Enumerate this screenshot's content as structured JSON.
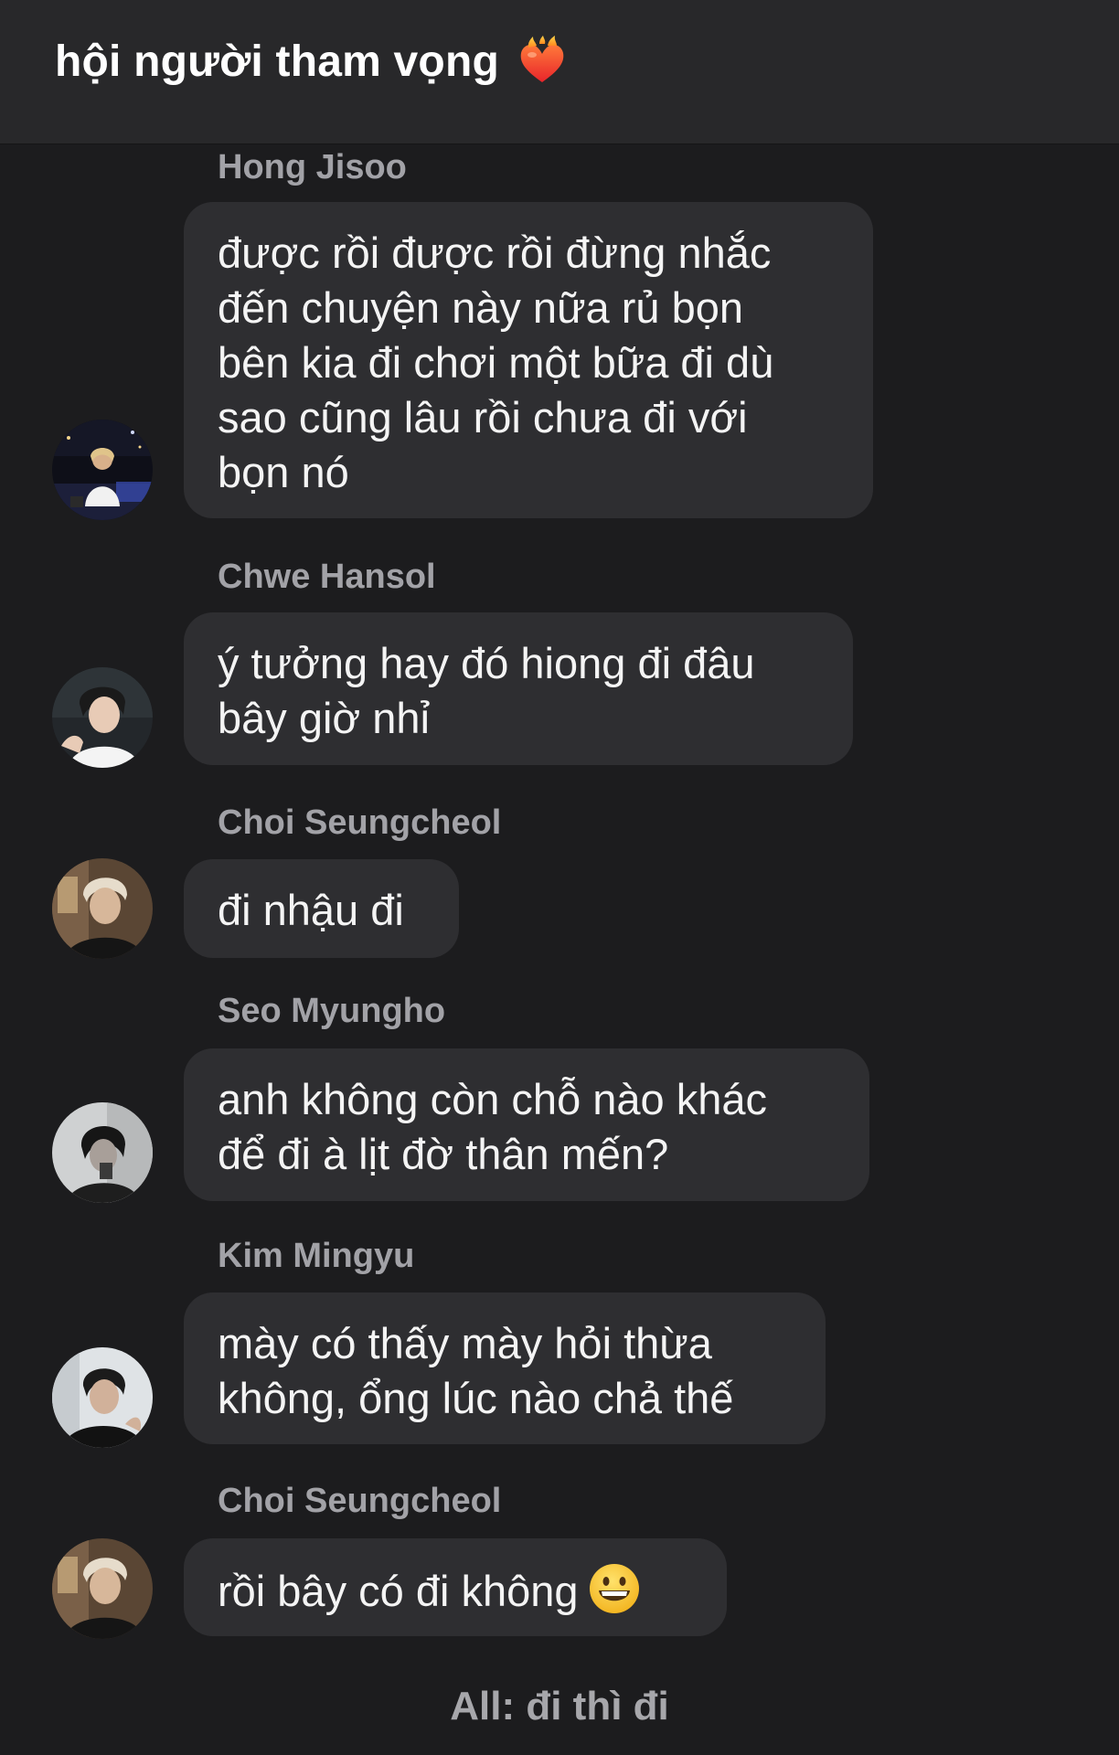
{
  "header": {
    "title": "hội người tham vọng",
    "title_icon": "flaming-heart-icon"
  },
  "messages": [
    {
      "sender": "Hong Jisoo",
      "text": "được rồi được rồi đừng nhắc\nđến chuyện này nữa rủ bọn\nbên kia đi chơi một bữa đi dù\nsao cũng lâu rồi chưa đi với\nbọn nó",
      "avatar": "avatar-photo"
    },
    {
      "sender": "Chwe Hansol",
      "text": "ý tưởng hay đó hiong đi đâu\nbây giờ nhỉ",
      "avatar": "avatar-photo"
    },
    {
      "sender": "Choi Seungcheol",
      "text": "đi nhậu đi",
      "avatar": "avatar-photo"
    },
    {
      "sender": "Seo Myungho",
      "text": "anh không còn chỗ nào khác\nđể đi à lịt đờ thân mến?",
      "avatar": "avatar-photo"
    },
    {
      "sender": "Kim Mingyu",
      "text": "mày có thấy mày hỏi thừa\nkhông, ổng lúc nào chả thế",
      "avatar": "avatar-photo"
    },
    {
      "sender": "Choi Seungcheol",
      "text": "rồi bây có đi không",
      "emoji": "grinning-face-icon",
      "avatar": "avatar-photo"
    }
  ],
  "footer": {
    "text": "All: đi thì đi"
  },
  "colors": {
    "background": "#1c1c1e",
    "header": "#28282a",
    "bubble": "#2e2e31",
    "sender": "#a2a2a7"
  }
}
